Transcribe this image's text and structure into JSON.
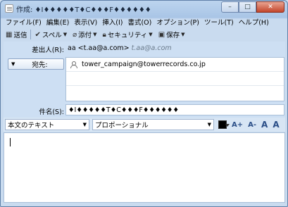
{
  "window": {
    "title": "作成: ♦I♦♦♦♦♦T♦C♦♦♦F♦♦♦♦♦♦",
    "min_label": "–",
    "max_label": "□",
    "close_label": "✕"
  },
  "menu": [
    "ファイル(F)",
    "編集(E)",
    "表示(V)",
    "挿入(I)",
    "書式(O)",
    "オプション(P)",
    "ツール(T)",
    "ヘルプ(H)"
  ],
  "toolbar": {
    "send": "送信",
    "spell": "スペル",
    "attach": "添付",
    "security": "セキュリティ",
    "save": "保存"
  },
  "header": {
    "from_label": "差出人(R):",
    "from_value": "aa <t.aa@a.com>",
    "from_hint": "t.aa@a.com",
    "to_label": "宛先:",
    "recipients": [
      "tower_campaign@towerrecords.co.jp",
      "",
      ""
    ],
    "subject_label": "件名(S):",
    "subject_value": "♦I♦♦♦♦♦T♦C♦♦♦F♦♦♦♦♦♦"
  },
  "format": {
    "paragraph_style": "本文のテキスト",
    "font": "プロポーショナル",
    "color": "#000000",
    "btn_larger": "A+",
    "btn_smaller": "A-",
    "btn_a1": "A",
    "btn_a2": "A"
  }
}
